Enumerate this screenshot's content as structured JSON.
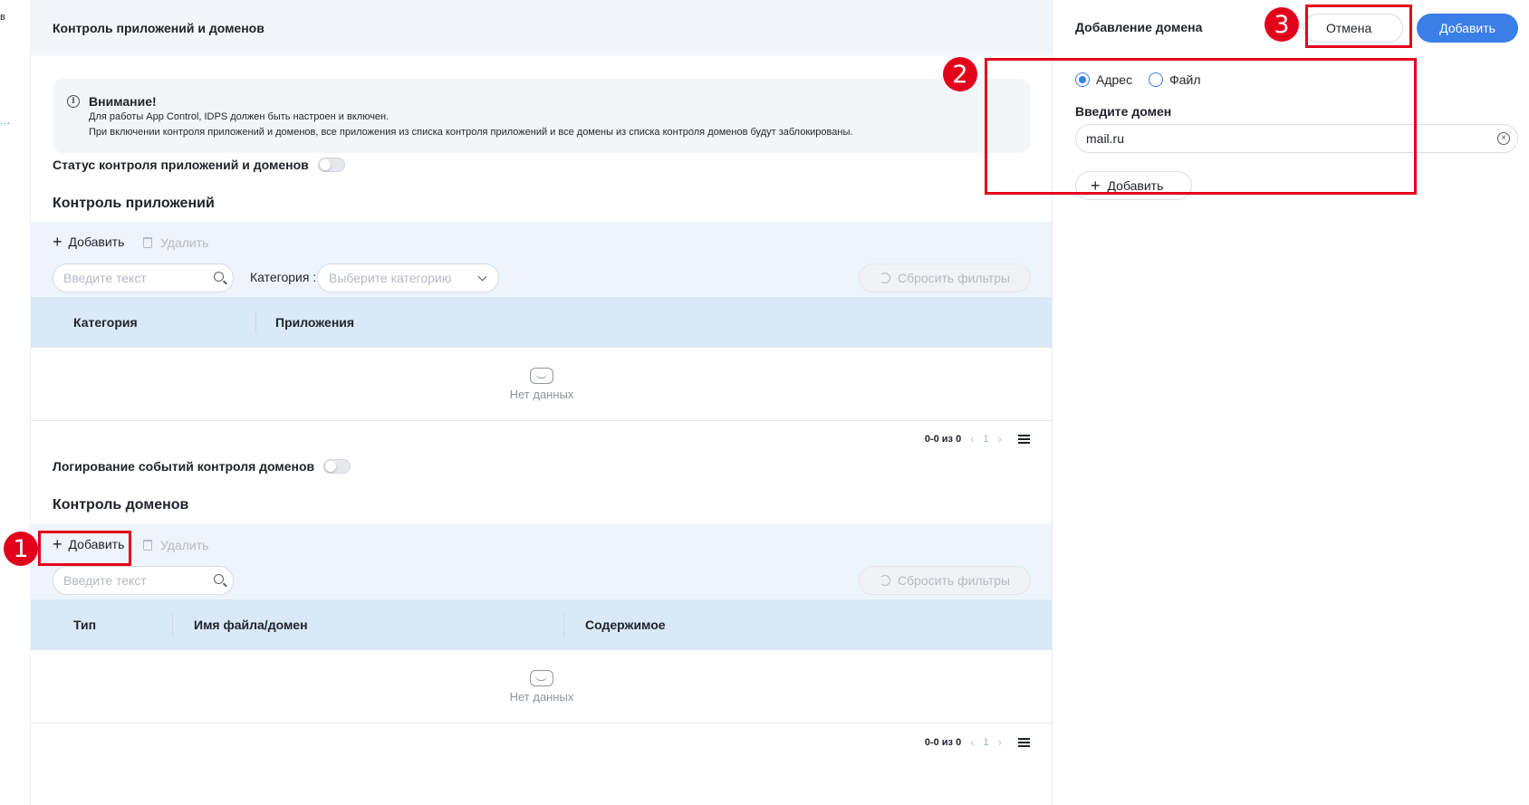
{
  "edge": {
    "char_top": "в",
    "dots": "..."
  },
  "header": {
    "title": "Контроль приложений и доменов"
  },
  "alert": {
    "title": "Внимание!",
    "line1": "Для работы App Control, IDPS должен быть настроен и включен.",
    "line2": "При включении контроля приложений и доменов, все приложения из списка контроля приложений и все домены из списка контроля доменов будут заблокированы."
  },
  "status_toggle": {
    "label": "Статус контроля приложений и доменов",
    "enabled": false
  },
  "apps": {
    "title": "Контроль приложений",
    "add_label": "Добавить",
    "delete_label": "Удалить",
    "search_placeholder": "Введите текст",
    "category_label": "Категория :",
    "category_placeholder": "Выберите категорию",
    "reset_label": "Сбросить фильтры",
    "columns": [
      "Категория",
      "Приложения"
    ],
    "empty_text": "Нет данных",
    "pagination": {
      "range": "0-0 из 0",
      "page": "1"
    }
  },
  "logging_toggle": {
    "label": "Логирование событий контроля доменов",
    "enabled": false
  },
  "domains": {
    "title": "Контроль доменов",
    "add_label": "Добавить",
    "delete_label": "Удалить",
    "search_placeholder": "Введите текст",
    "reset_label": "Сбросить фильтры",
    "columns": [
      "Тип",
      "Имя файла/домен",
      "Содержимое"
    ],
    "empty_text": "Нет данных",
    "pagination": {
      "range": "0-0 из 0",
      "page": "1"
    }
  },
  "panel": {
    "title": "Добавление домена",
    "cancel_label": "Отмена",
    "submit_label": "Добавить",
    "radio_options": [
      {
        "label": "Адрес",
        "selected": true
      },
      {
        "label": "Файл",
        "selected": false
      }
    ],
    "field_label": "Введите домен",
    "field_value": "mail.ru",
    "add_label": "Добавить"
  },
  "annotations": [
    "1",
    "2",
    "3"
  ],
  "colors": {
    "primary": "#3a7ee8",
    "highlight": "#e3001b",
    "header_bg": "#f2f6fb",
    "table_head_bg": "#d9e9f8"
  }
}
